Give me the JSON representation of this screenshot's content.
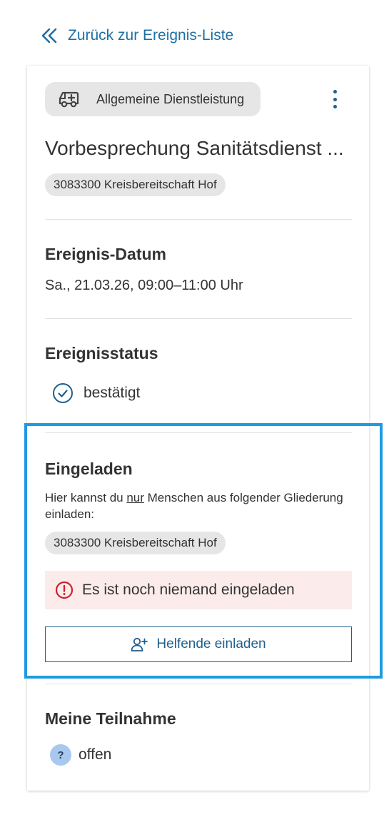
{
  "back_link": {
    "label": "Zurück zur Ereignis-Liste",
    "icon": "double-chevron-left-icon"
  },
  "event": {
    "type_label": "Allgemeine Dienstleistung",
    "type_icon": "ambulance-icon",
    "title": "Vorbesprechung Sanitätsdienst ...",
    "organization": "3083300 Kreisbereitschaft Hof"
  },
  "date_section": {
    "heading": "Ereignis-Datum",
    "value": "Sa., 21.03.26, 09:00–11:00 Uhr"
  },
  "status_section": {
    "heading": "Ereignisstatus",
    "value": "bestätigt",
    "icon": "check-circle-icon"
  },
  "invited_section": {
    "heading": "Eingeladen",
    "hint_before": "Hier kannst du ",
    "hint_emphasis": "nur",
    "hint_after": " Menschen aus folgender Gliederung einladen:",
    "organization": "3083300 Kreisbereitschaft Hof",
    "alert_text": "Es ist noch niemand eingeladen",
    "invite_button": "Helfende einladen"
  },
  "participation_section": {
    "heading": "Meine Teilnahme",
    "badge": "?",
    "value": "offen"
  },
  "colors": {
    "link": "#1f6fa3",
    "primary": "#1f5f8b",
    "highlight_border": "#1f9ae0",
    "alert_bg": "#fbeceb",
    "alert_icon": "#d0202e",
    "chip_bg": "#e6e6e6",
    "open_badge": "#a9c8ee"
  }
}
